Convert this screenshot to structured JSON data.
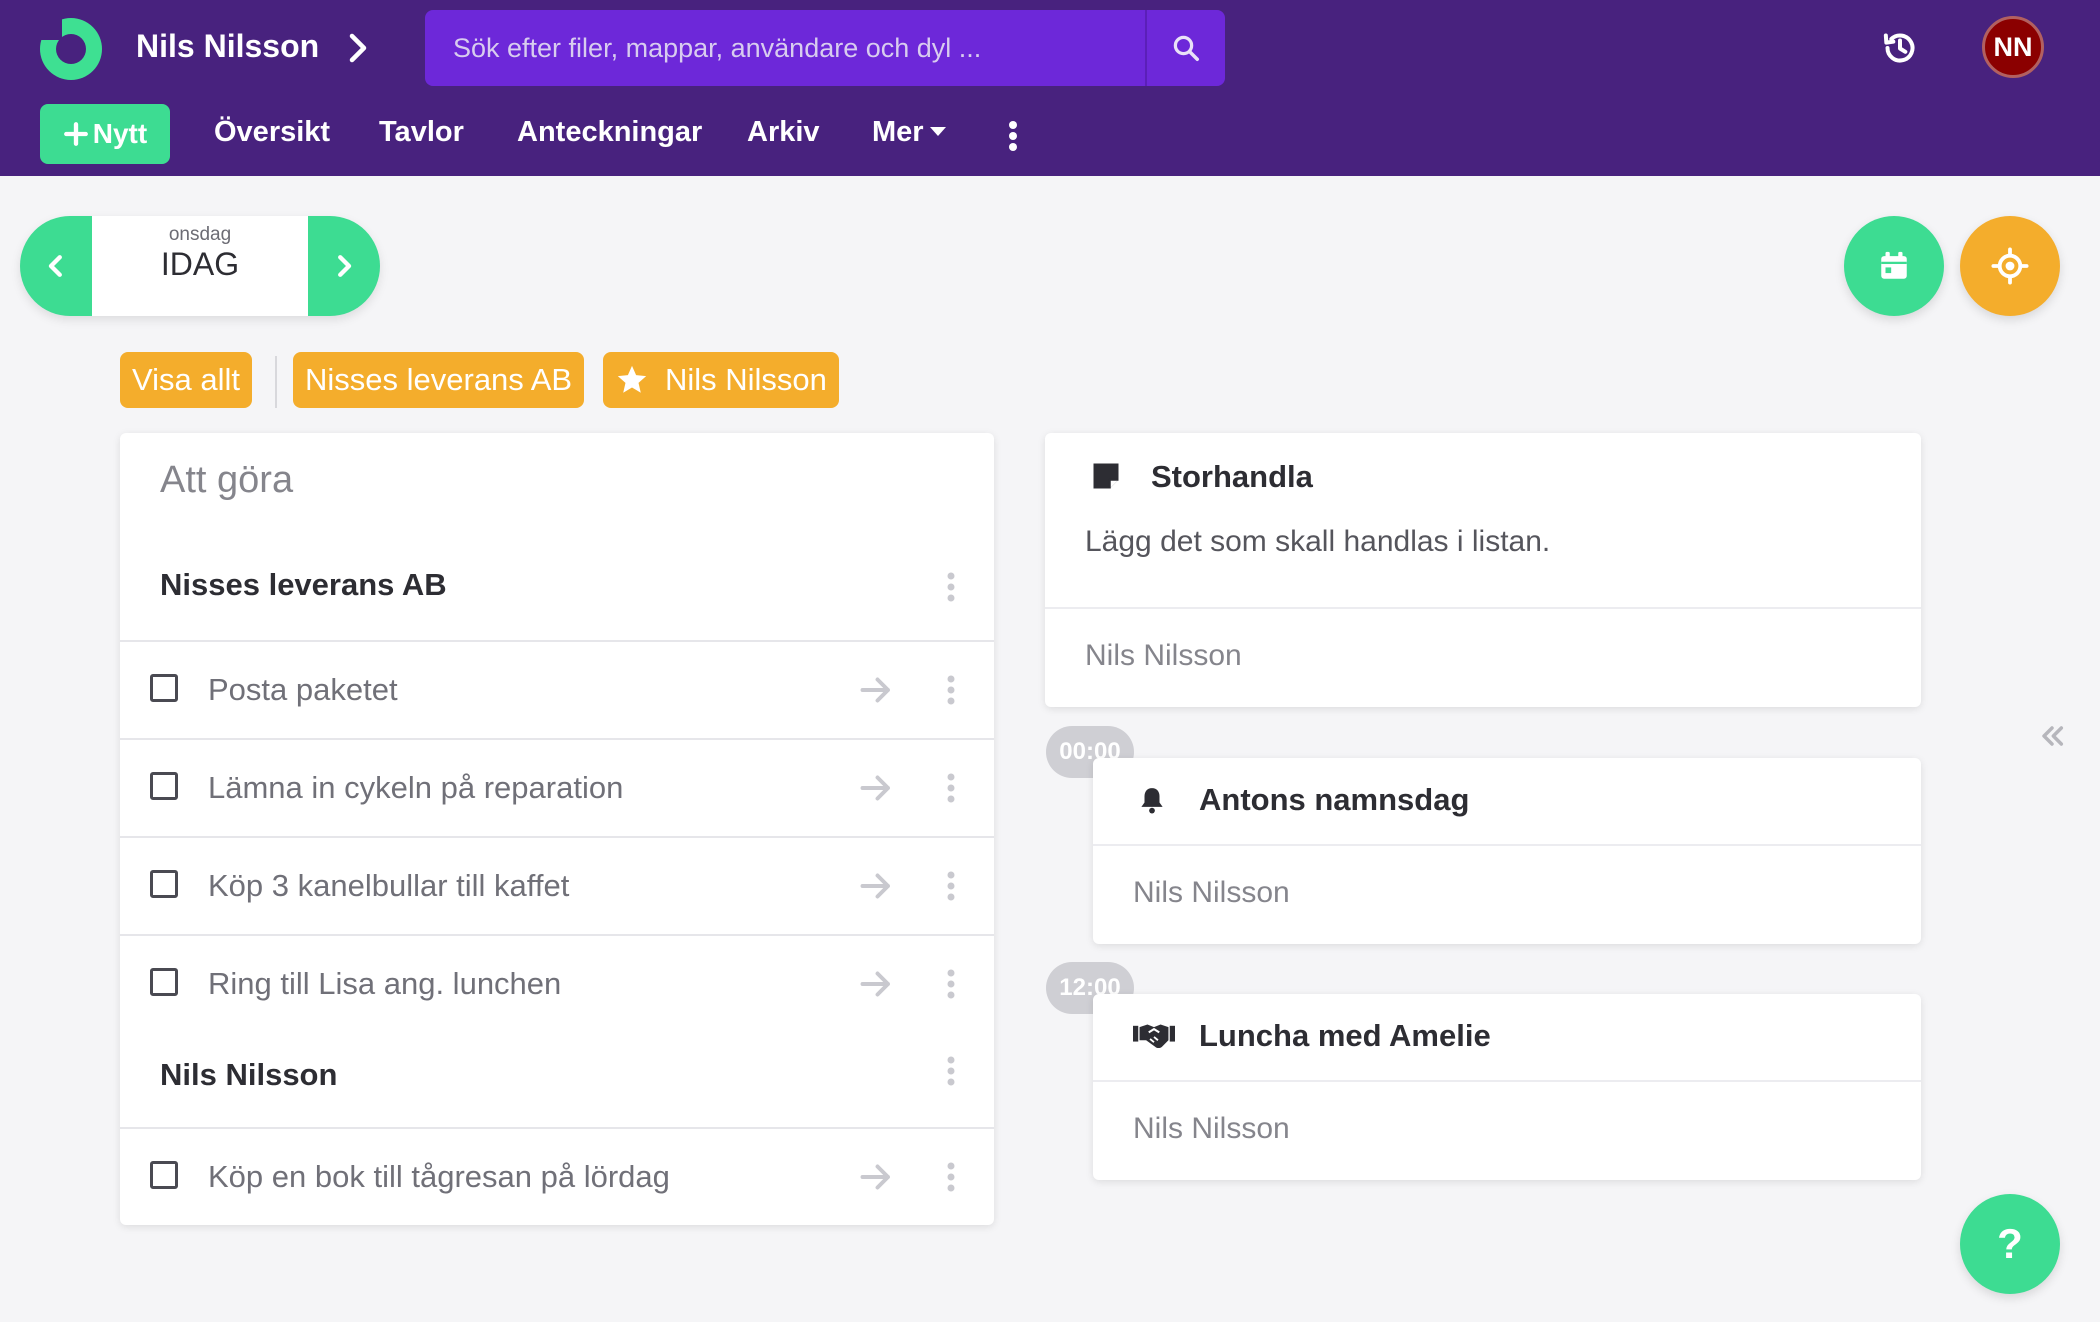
{
  "header": {
    "user_name": "Nils Nilsson",
    "search_placeholder": "Sök efter filer, mappar, användare och dyl ...",
    "avatar_initials": "NN",
    "colors": {
      "header_bg": "#48227e",
      "search_bg": "#6d28d9",
      "accent_green": "#3ddc92",
      "accent_orange": "#f4ad2c",
      "avatar_bg": "#8b0000"
    }
  },
  "nav": {
    "new_label": "Nytt",
    "items": [
      "Översikt",
      "Tavlor",
      "Anteckningar",
      "Arkiv",
      "Mer"
    ]
  },
  "date_nav": {
    "weekday": "onsdag",
    "label": "IDAG"
  },
  "filters": [
    "Visa allt",
    "Nisses leverans AB",
    "Nils Nilsson"
  ],
  "todo": {
    "title": "Att göra",
    "groups": [
      {
        "name": "Nisses leverans AB",
        "tasks": [
          "Posta paketet",
          "Lämna in cykeln på reparation",
          "Köp 3 kanelbullar till kaffet",
          "Ring till Lisa ang. lunchen"
        ]
      },
      {
        "name": "Nils Nilsson",
        "tasks": [
          "Köp en bok till tågresan på lördag"
        ]
      }
    ]
  },
  "events": [
    {
      "icon": "note-icon",
      "title": "Storhandla",
      "body": "Lägg det som skall handlas i listan.",
      "owner": "Nils Nilsson"
    },
    {
      "time": "00:00",
      "icon": "bell-icon",
      "title": "Antons namnsdag",
      "owner": "Nils Nilsson"
    },
    {
      "time": "12:00",
      "icon": "handshake-icon",
      "title": "Luncha med Amelie",
      "owner": "Nils Nilsson"
    }
  ],
  "help_label": "?"
}
